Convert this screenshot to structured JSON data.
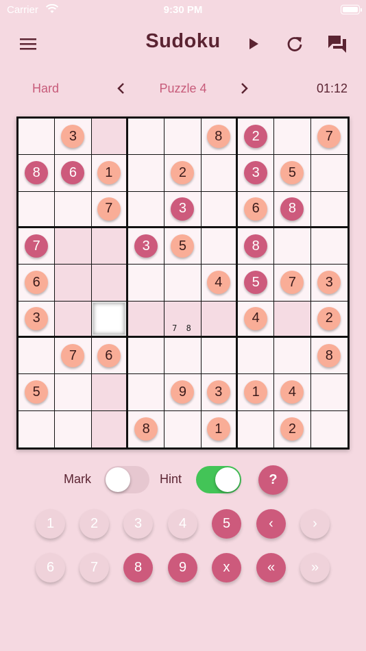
{
  "status_bar": {
    "carrier": "Carrier",
    "time": "9:30 PM"
  },
  "header": {
    "title": "Sudoku"
  },
  "nav": {
    "difficulty": "Hard",
    "puzzle": "Puzzle 4",
    "timer": "01:12"
  },
  "board": {
    "rows": [
      [
        [
          null,
          ""
        ],
        [
          "3",
          "g"
        ],
        [
          null,
          ""
        ],
        [
          null,
          ""
        ],
        [
          null,
          ""
        ],
        [
          "8",
          "g"
        ],
        [
          "2",
          "u"
        ],
        [
          null,
          ""
        ],
        [
          "7",
          "g"
        ]
      ],
      [
        [
          "8",
          "u"
        ],
        [
          "6",
          "u"
        ],
        [
          "1",
          "g"
        ],
        [
          null,
          ""
        ],
        [
          "2",
          "g"
        ],
        [
          null,
          ""
        ],
        [
          "3",
          "u"
        ],
        [
          "5",
          "g"
        ],
        [
          null,
          ""
        ]
      ],
      [
        [
          null,
          ""
        ],
        [
          null,
          ""
        ],
        [
          "7",
          "g"
        ],
        [
          null,
          ""
        ],
        [
          "3",
          "u"
        ],
        [
          null,
          ""
        ],
        [
          "6",
          "g"
        ],
        [
          "8",
          "u"
        ],
        [
          null,
          ""
        ]
      ],
      [
        [
          "7",
          "u"
        ],
        [
          null,
          ""
        ],
        [
          null,
          ""
        ],
        [
          "3",
          "u"
        ],
        [
          "5",
          "g"
        ],
        [
          null,
          ""
        ],
        [
          "8",
          "u"
        ],
        [
          null,
          ""
        ],
        [
          null,
          ""
        ]
      ],
      [
        [
          "6",
          "g"
        ],
        [
          null,
          ""
        ],
        [
          null,
          ""
        ],
        [
          null,
          ""
        ],
        [
          null,
          ""
        ],
        [
          "4",
          "g"
        ],
        [
          "5",
          "u"
        ],
        [
          "7",
          "g"
        ],
        [
          "3",
          "g"
        ]
      ],
      [
        [
          "3",
          "g"
        ],
        [
          null,
          ""
        ],
        [
          null,
          ""
        ],
        [
          null,
          ""
        ],
        [
          null,
          ""
        ],
        [
          null,
          ""
        ],
        [
          "4",
          "g"
        ],
        [
          null,
          ""
        ],
        [
          "2",
          "g"
        ]
      ],
      [
        [
          null,
          ""
        ],
        [
          "7",
          "g"
        ],
        [
          "6",
          "g"
        ],
        [
          null,
          ""
        ],
        [
          null,
          ""
        ],
        [
          null,
          ""
        ],
        [
          null,
          ""
        ],
        [
          null,
          ""
        ],
        [
          "8",
          "g"
        ]
      ],
      [
        [
          "5",
          "g"
        ],
        [
          null,
          ""
        ],
        [
          null,
          ""
        ],
        [
          null,
          ""
        ],
        [
          "9",
          "g"
        ],
        [
          "3",
          "g"
        ],
        [
          "1",
          "g"
        ],
        [
          "4",
          "g"
        ],
        [
          null,
          ""
        ]
      ],
      [
        [
          null,
          ""
        ],
        [
          null,
          ""
        ],
        [
          null,
          ""
        ],
        [
          "8",
          "g"
        ],
        [
          null,
          ""
        ],
        [
          "1",
          "g"
        ],
        [
          null,
          ""
        ],
        [
          "2",
          "g"
        ],
        [
          null,
          ""
        ]
      ]
    ],
    "selected": [
      5,
      2
    ],
    "notes": [
      {
        "row": 5,
        "col": 4,
        "text": "7 8"
      }
    ]
  },
  "controls": {
    "mark_label": "Mark",
    "mark_on": false,
    "hint_label": "Hint",
    "hint_on": true,
    "help_label": "?"
  },
  "keypad": {
    "row1": [
      {
        "label": "1",
        "enabled": false
      },
      {
        "label": "2",
        "enabled": false
      },
      {
        "label": "3",
        "enabled": false
      },
      {
        "label": "4",
        "enabled": false
      },
      {
        "label": "5",
        "enabled": true
      },
      {
        "label": "‹",
        "enabled": true
      },
      {
        "label": "›",
        "enabled": false
      }
    ],
    "row2": [
      {
        "label": "6",
        "enabled": false
      },
      {
        "label": "7",
        "enabled": false
      },
      {
        "label": "8",
        "enabled": true
      },
      {
        "label": "9",
        "enabled": true
      },
      {
        "label": "x",
        "enabled": true
      },
      {
        "label": "«",
        "enabled": true
      },
      {
        "label": "»",
        "enabled": false
      }
    ]
  },
  "colors": {
    "background": "#f5d9e1",
    "accent": "#cd5a7c",
    "given_token": "#f9ad97",
    "title": "#5b2432",
    "toggle_on": "#43c457"
  }
}
